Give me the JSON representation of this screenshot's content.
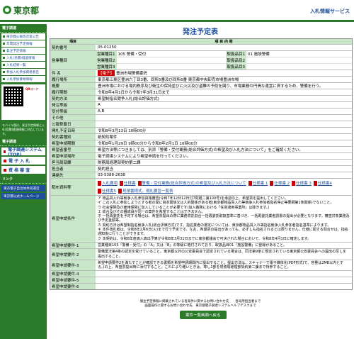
{
  "header": {
    "logo_text": "東京都",
    "system_title": "入札情報サービス"
  },
  "sidebar": {
    "section1": "電子調達",
    "items": [
      "東京都公報等次第公告",
      "年間発注予定情報",
      "発注予定情報",
      "入札(見積)経過情報",
      "入札結果一覧",
      "参加入札参加資格者名",
      "入札参加資格情報"
    ],
    "qr_label": "QRコード",
    "mobile_note": "モバイル版は、発注予定情報と入札(見積)経過情報に対応しています。",
    "section2": "電子調達",
    "buttons": [
      "電子調達システム(TOP)",
      "電 子 入 札",
      "資 格 審 査"
    ],
    "section3": "リンク",
    "links": [
      "東京電子自治体共同運営",
      "東京都公式ホームページ"
    ]
  },
  "main": {
    "title": "発注予定表",
    "col_item": "項目",
    "col_content": "項 目 内 容",
    "rows": [
      {
        "k": "契約番号",
        "v": "05-01250"
      },
      {
        "k": "営業種目",
        "v": ""
      },
      {
        "k": "営業種目",
        "v": ""
      },
      {
        "k": "件 名",
        "v": "豊洲市場警備委託"
      },
      {
        "k": "履行場所",
        "v": "東京都江東区豊洲六丁目3番、同所5番及び同所6番 東京都中央卸売市場豊洲市場"
      },
      {
        "k": "概要",
        "v": "豊洲市場における場内秩序及び衛生の保持並びに火災及び盗難の予防を図り、市場業務の円滑な運営に資するため、警備を行う。"
      },
      {
        "k": "履行期間",
        "v": "令和8年4月1日から令和7年3月31日まで"
      },
      {
        "k": "契約方法",
        "v": "希望制指名競争入札(総合評価方式)"
      },
      {
        "k": "発注等級",
        "v": "A"
      },
      {
        "k": "受付等級",
        "v": "A,B"
      },
      {
        "k": "その他",
        "v": ""
      },
      {
        "k": "公報登載日",
        "v": ""
      },
      {
        "k": "開札予定日時",
        "v": "令和8年3月13日 10時00分"
      },
      {
        "k": "契約書種別",
        "v": "紙契約案件"
      },
      {
        "k": "希望申請期間",
        "v": "令和8年1月29日 9時00分から令和8年2月1日 16時00分"
      },
      {
        "k": "希望者番号",
        "v": "希望方法等につきましては、別添「警備・受付業務(総合評価方式)の希望及び入札方法について」をご確認ください。"
      },
      {
        "k": "希望申請場所",
        "v": "電子調達システムにより希望申請を行ってください。"
      },
      {
        "k": "担当局部課",
        "v": "財務局経理部契約第二課"
      },
      {
        "k": "担当者",
        "v": "契約担当"
      },
      {
        "k": "連絡先",
        "v": "03-5388-2638"
      }
    ],
    "eigyo": [
      {
        "label1": "営業種目1",
        "val1": "105 警備・受付",
        "label2": "取扱品目1",
        "val2": "01 施設警備"
      },
      {
        "label1": "営業種目2",
        "val1": "",
        "label2": "取扱品目2",
        "val2": ""
      },
      {
        "label1": "営業種目3",
        "val1": "",
        "label2": "取扱品目3",
        "val2": ""
      }
    ],
    "red_tag": "【電子】",
    "attach_label": "配布資料等",
    "attachments": [
      "入札要項",
      "仕様書",
      "警備・受付業務(総合評価方式)の希望及び入札方法について",
      "仕様書 1",
      "仕様書 2",
      "仕様書 3",
      "仕様書4",
      "仕様書5",
      "見積書様式、現札要旨一覧表"
    ],
    "conditions_label": "希望申請条件",
    "conditions": "ア 物品買入れ等競争入札参加資格審査(令和7年12月12日付7財経二第100号)を承認の上、希望票を提出してください。\nイ この入札に参加しようとする者の間に資本関係又は人的関係がある者(東京都物品買入れ等競争入札参加者指名停止等要綱第1条関係)でないこと。\nウ 社会保険及び雇用保険に加入していることが必要です(加入義務における「任意適用事業所」は除きます。)\nエ 総合及びその構成員が同一の案件を希望することはできません。\nオ 一括再委託を予定する場合は、希望票提出の際に業務収託割合一括再委託取扱基準に基づき、一括再委託業者調書の提出が必要となります。審査対象業務及び予定金額等。\nカ 契約方法は希望制指名競争入札(総合評価方式)です。指名業者の選定については、東京都物品買入れ等指名競争入札参加者指名基準によります。\nキ 本件落札者は、令和8年2月6日(火)まで行う予定です。なお、希望票の提出があっても、必ずしも指名されるとは限りません。仕様に関する問合せは、指名通知後に行うことができます。\nク 本契約は、令和8年度歳入歳出予算が令和8年3月31日までに東京都議会で可決された場合において、令和8年4月1日に確定します。",
    "extra_rows": [
      {
        "k": "希望申請要件-1",
        "v": "営業種目105「警備・受付」の「A」又は「B」の等級に格付されており、取扱品目01「施設警備」に登録があること。"
      },
      {
        "k": "希望申請要件-2",
        "v": "警備業法第4条の認定を受けていること。東京都以外の公安委員会で認定されている場合は、同法第9条に規定されている東京都公安委員会への届出の写しを提出すること。"
      },
      {
        "k": "希望申請要件-3",
        "v": "希望申請要件2を満たすことが確認できる書類を希望申請期間内に提出すること。提出方法は、スキャナーで電子媒体化(PDF形式)で、容量は2MB以内とする。)の上、希望票提出時に添付すること。これにより難いときは、等し1部を財務局経理部契約第二課まで持参すること。"
      },
      {
        "k": "希望申請要件-4",
        "v": ""
      },
      {
        "k": "希望申請要件-5",
        "v": ""
      },
      {
        "k": "希望申請要件-6",
        "v": ""
      }
    ],
    "back_button": "案件一覧画面へ戻る"
  },
  "footer": {
    "line1": "発注予定情報に掲載されている各案件に関するお問い合わせ先　　各局所担当者まで",
    "line2": "画面操作に関するお問い合わせ先　東京都電子調達システムヘルプデスクまで"
  }
}
